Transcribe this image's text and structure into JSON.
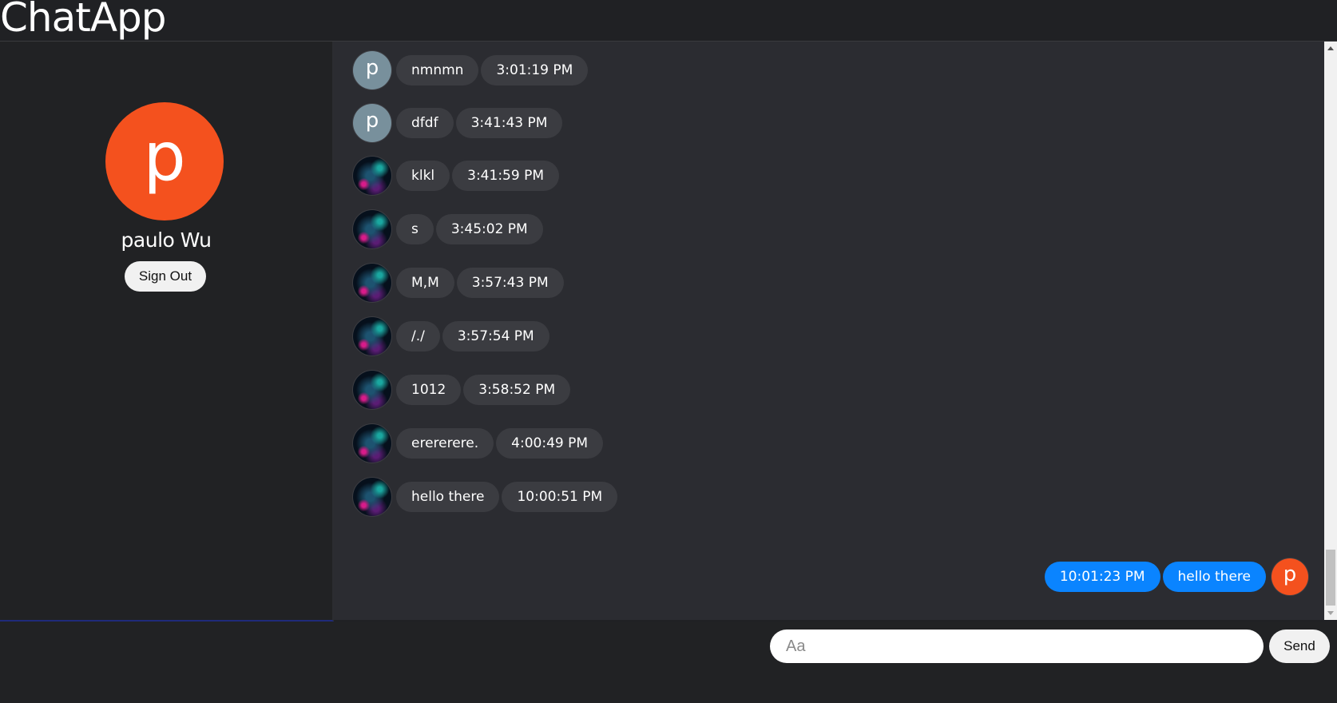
{
  "header": {
    "title": "ChatApp"
  },
  "profile": {
    "initial": "p",
    "name": "paulo Wu",
    "sign_out_label": "Sign Out"
  },
  "messages": [
    {
      "avatar": "p",
      "avatar_type": "letter",
      "text": "nmnmn",
      "time": "3:01:19 PM"
    },
    {
      "avatar": "p",
      "avatar_type": "letter",
      "text": "dfdf",
      "time": "3:41:43 PM"
    },
    {
      "avatar": "galaxy-avatar",
      "avatar_type": "image",
      "text": "klkl",
      "time": "3:41:59 PM"
    },
    {
      "avatar": "galaxy-avatar",
      "avatar_type": "image",
      "text": "s",
      "time": "3:45:02 PM"
    },
    {
      "avatar": "galaxy-avatar",
      "avatar_type": "image",
      "text": "M,M",
      "time": "3:57:43 PM"
    },
    {
      "avatar": "galaxy-avatar",
      "avatar_type": "image",
      "text": "/./",
      "time": "3:57:54 PM"
    },
    {
      "avatar": "galaxy-avatar",
      "avatar_type": "image",
      "text": "1012",
      "time": "3:58:52 PM"
    },
    {
      "avatar": "galaxy-avatar",
      "avatar_type": "image",
      "text": "erererere.",
      "time": "4:00:49 PM"
    },
    {
      "avatar": "galaxy-avatar",
      "avatar_type": "image",
      "text": "hello there",
      "time": "10:00:51 PM"
    }
  ],
  "my_message": {
    "time": "10:01:23 PM",
    "text": "hello there",
    "avatar": "p"
  },
  "composer": {
    "placeholder": "Aa",
    "value": "",
    "send_label": "Send"
  },
  "colors": {
    "background": "#202124",
    "chat_background": "#2b2c31",
    "bubble_other": "#3b3c41",
    "bubble_mine": "#0a84ff",
    "avatar_orange": "#f4511e",
    "avatar_gray": "#78909c"
  }
}
